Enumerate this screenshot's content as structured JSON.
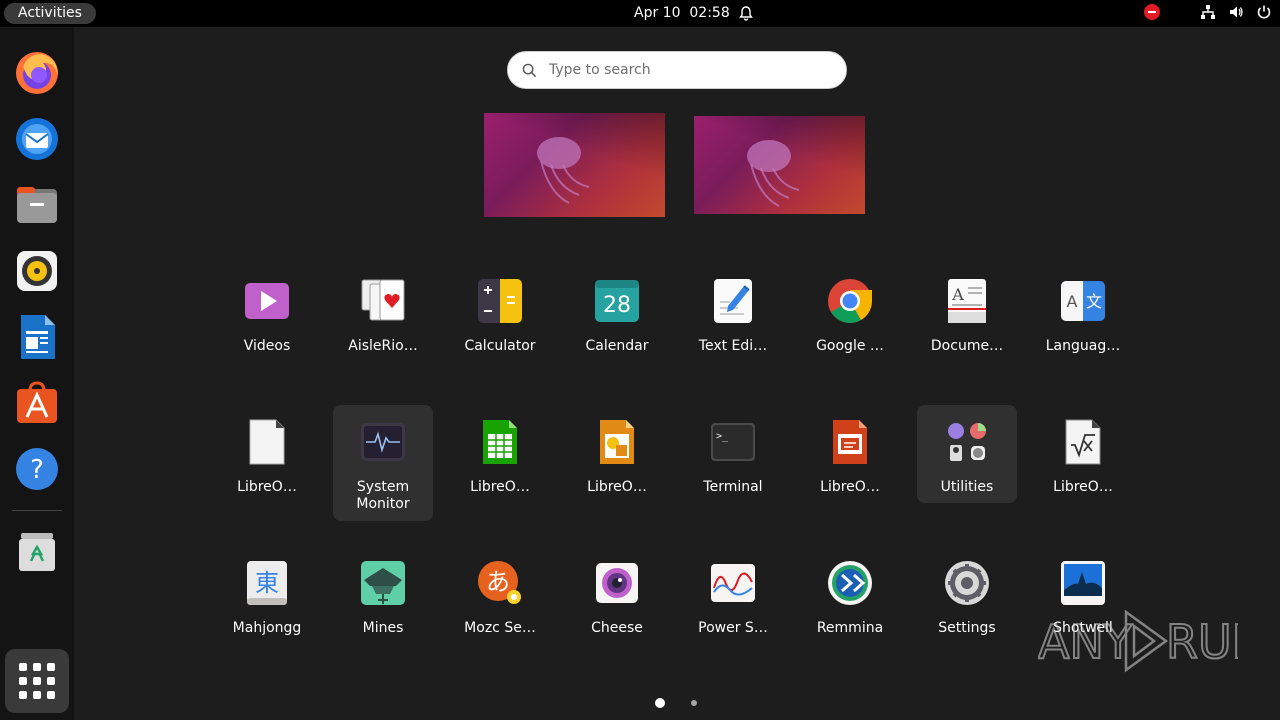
{
  "topbar": {
    "activities": "Activities",
    "date": "Apr 10",
    "time": "02:58"
  },
  "dock": {
    "items": [
      {
        "name": "firefox-icon"
      },
      {
        "name": "thunderbird-icon"
      },
      {
        "name": "files-icon"
      },
      {
        "name": "rhythmbox-icon"
      },
      {
        "name": "libreoffice-writer-icon"
      },
      {
        "name": "app-center-icon"
      },
      {
        "name": "help-icon"
      },
      {
        "name": "trash-icon"
      }
    ],
    "show_apps": "show-apps-grid-icon"
  },
  "search": {
    "placeholder": "Type to search"
  },
  "apps": [
    {
      "label": "Videos",
      "icon": "videos-icon"
    },
    {
      "label": "AisleRio…",
      "icon": "aisleriot-icon"
    },
    {
      "label": "Calculator",
      "icon": "calculator-icon"
    },
    {
      "label": "Calendar",
      "icon": "calendar-icon",
      "badge": "28"
    },
    {
      "label": "Text Edi…",
      "icon": "text-editor-icon"
    },
    {
      "label": "Google …",
      "icon": "chrome-icon"
    },
    {
      "label": "Docume…",
      "icon": "document-viewer-icon"
    },
    {
      "label": "Languag…",
      "icon": "language-icon",
      "glyphs": [
        "A",
        "文"
      ]
    },
    {
      "label": "LibreO…",
      "icon": "libreoffice-icon"
    },
    {
      "label": "System Monitor",
      "line1": "System",
      "line2": "Monitor",
      "icon": "system-monitor-icon"
    },
    {
      "label": "LibreO…",
      "icon": "libreoffice-calc-icon"
    },
    {
      "label": "LibreO…",
      "icon": "libreoffice-draw-icon"
    },
    {
      "label": "Terminal",
      "icon": "terminal-icon",
      "prompt": ">_"
    },
    {
      "label": "LibreO…",
      "icon": "libreoffice-impress-icon"
    },
    {
      "label": "Utilities",
      "icon": "utilities-folder-icon"
    },
    {
      "label": "LibreO…",
      "icon": "libreoffice-math-icon"
    },
    {
      "label": "Mahjongg",
      "icon": "mahjongg-icon",
      "glyph": "東"
    },
    {
      "label": "Mines",
      "icon": "mines-icon"
    },
    {
      "label": "Mozc Se…",
      "icon": "mozc-icon",
      "glyph": "あ"
    },
    {
      "label": "Cheese",
      "icon": "cheese-icon"
    },
    {
      "label": "Power S…",
      "icon": "power-statistics-icon"
    },
    {
      "label": "Remmina",
      "icon": "remmina-icon"
    },
    {
      "label": "Settings",
      "icon": "settings-icon"
    },
    {
      "label": "Shotwell",
      "icon": "shotwell-icon"
    }
  ],
  "pager": {
    "pages": 2,
    "current": 1
  },
  "watermark": "ANY RUN"
}
